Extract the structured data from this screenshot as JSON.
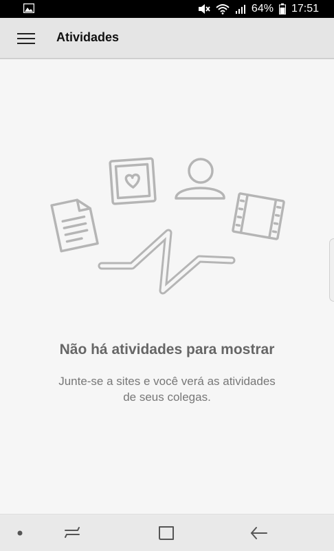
{
  "status_bar": {
    "battery": "64%",
    "time": "17:51",
    "icons": [
      "gallery-icon",
      "mute-icon",
      "wifi-icon",
      "signal-icon",
      "battery-icon"
    ]
  },
  "app_bar": {
    "title": "Atividades",
    "menu_icon": "hamburger-menu-icon"
  },
  "empty_state": {
    "title": "Não há atividades para mostrar",
    "subtitle_line1": "Junte-se a sites e você verá as atividades",
    "subtitle_line2": "de seus colegas."
  },
  "nav_bar": {
    "buttons": [
      "dot-icon",
      "recent-apps-icon",
      "home-icon",
      "back-icon"
    ]
  },
  "colors": {
    "status_bar_bg": "#000000",
    "app_bar_bg": "#e5e5e5",
    "page_bg": "#f6f6f6",
    "illustration_stroke": "#b5b5b5"
  }
}
